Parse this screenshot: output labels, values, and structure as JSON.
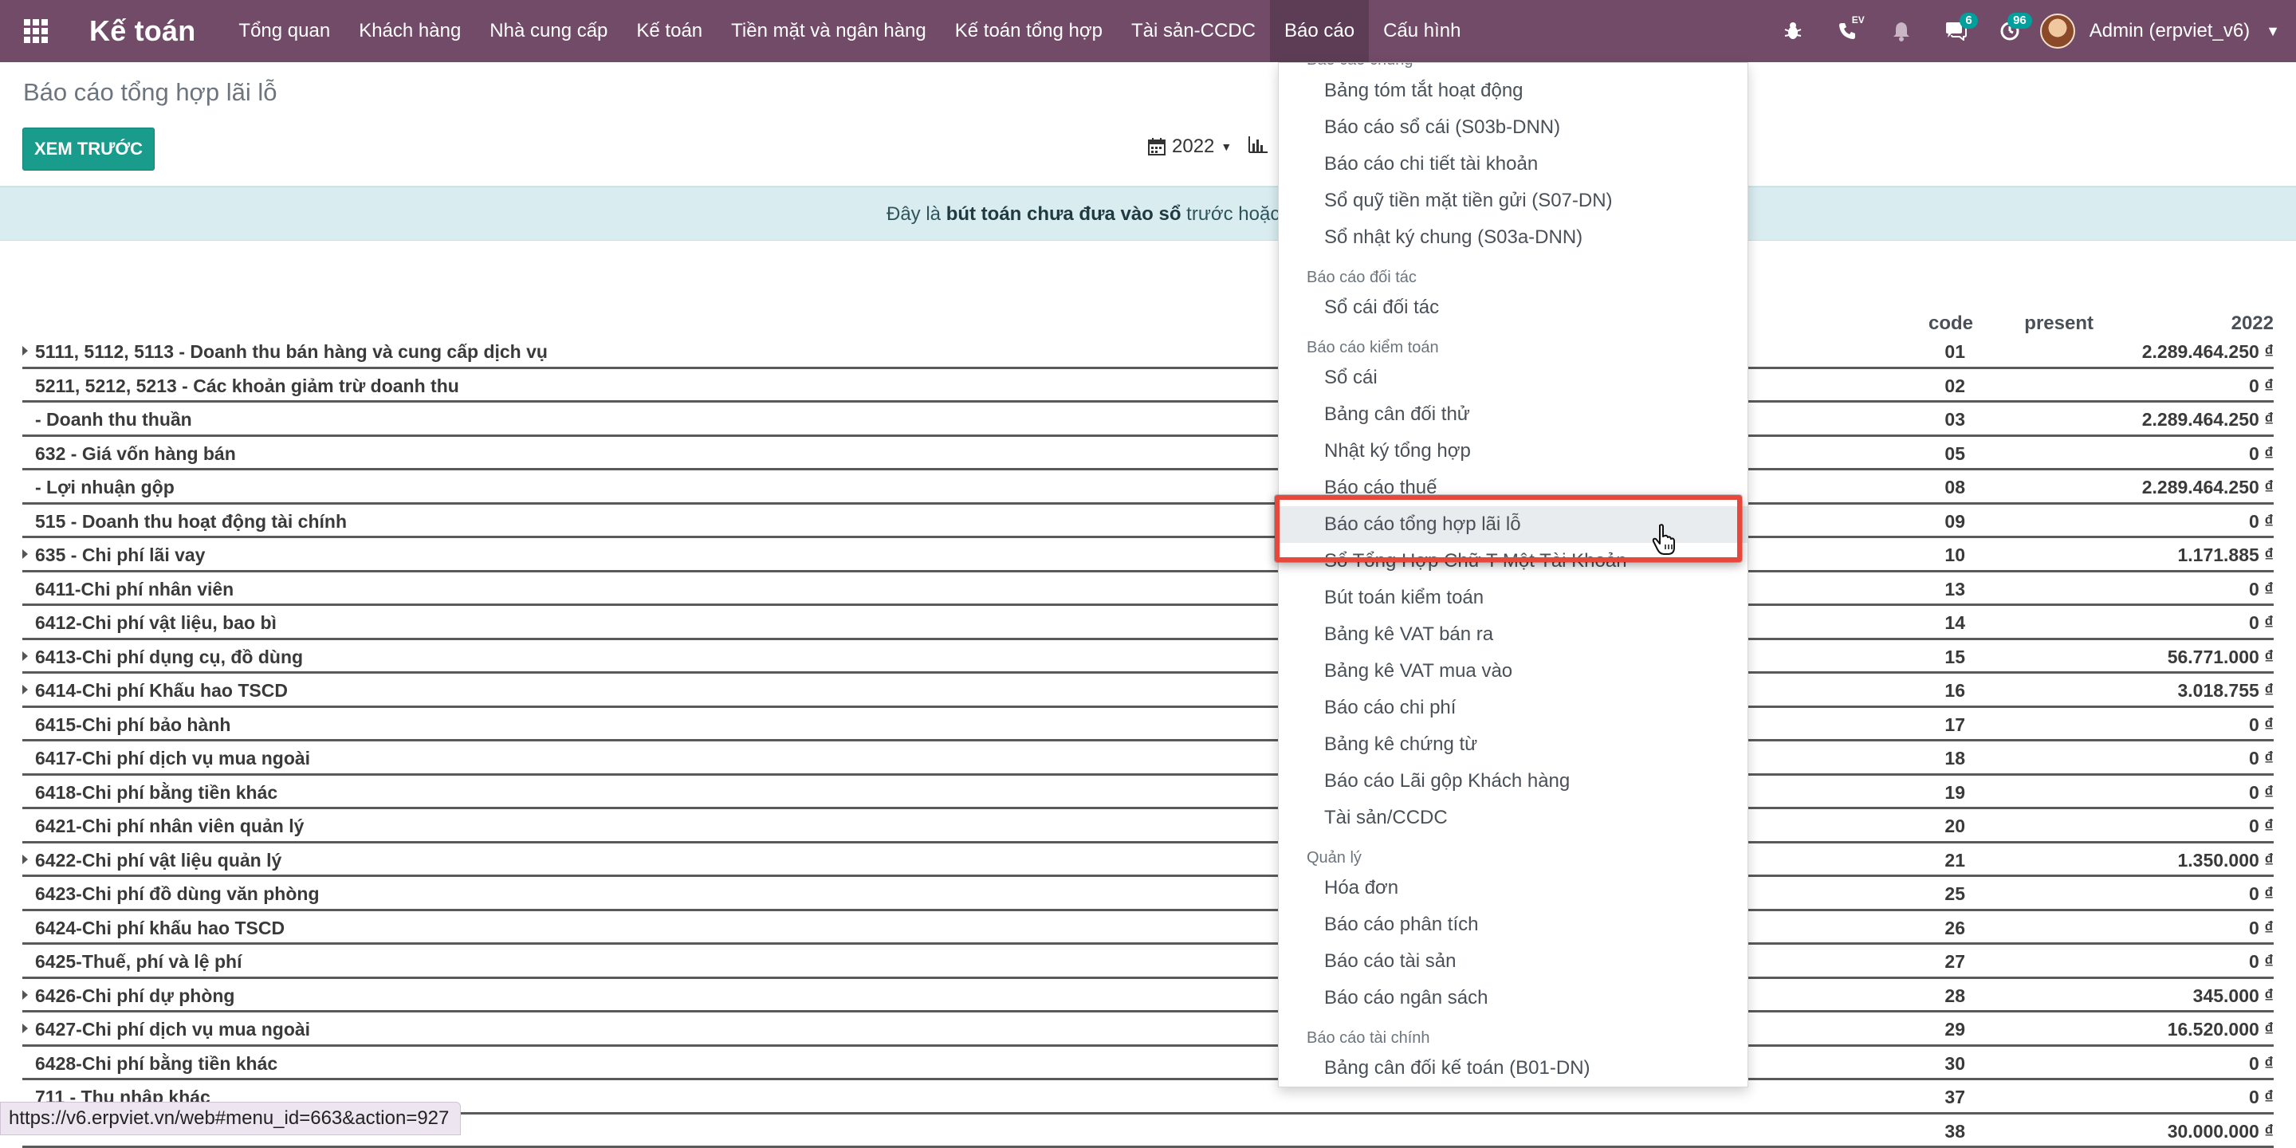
{
  "app": {
    "title": "Kế toán",
    "menu": [
      "Tổng quan",
      "Khách hàng",
      "Nhà cung cấp",
      "Kế toán",
      "Tiền mặt và ngân hàng",
      "Kế toán tổng hợp",
      "Tài sản-CCDC",
      "Báo cáo",
      "Cấu hình"
    ],
    "active_menu": "Báo cáo"
  },
  "systray": {
    "bug_icon": "bug-icon",
    "phone_tag": "EV",
    "messages_count": "6",
    "activities_count": "96",
    "user_label": "Admin (erpviet_v6)"
  },
  "page": {
    "breadcrumb": "Báo cáo tổng hợp lãi lỗ",
    "preview_button": "XEM TRƯỚC",
    "year_filter": "2022",
    "alert_prefix": "Đây là ",
    "alert_bold": "bút toán chưa đưa vào sổ",
    "alert_suffix": " trước hoặc tro"
  },
  "report": {
    "headers": {
      "code": "code",
      "present": "present",
      "year": "2022"
    },
    "rows": [
      {
        "name": "5111, 5112, 5113 - Doanh thu bán hàng và cung cấp dịch vụ",
        "code": "01",
        "amount": "2.289.464.250 ₫",
        "expandable": true
      },
      {
        "name": "5211, 5212, 5213 - Các khoản giảm trừ doanh thu",
        "code": "02",
        "amount": "0 ₫",
        "expandable": false
      },
      {
        "name": "- Doanh thu thuần",
        "code": "03",
        "amount": "2.289.464.250 ₫",
        "expandable": false
      },
      {
        "name": "632 - Giá vốn hàng bán",
        "code": "05",
        "amount": "0 ₫",
        "expandable": false
      },
      {
        "name": "- Lợi nhuận gộp",
        "code": "08",
        "amount": "2.289.464.250 ₫",
        "expandable": false
      },
      {
        "name": "515 - Doanh thu hoạt động tài chính",
        "code": "09",
        "amount": "0 ₫",
        "expandable": false
      },
      {
        "name": "635 - Chi phí lãi vay",
        "code": "10",
        "amount": "1.171.885 ₫",
        "expandable": true
      },
      {
        "name": "6411-Chi phí nhân viên",
        "code": "13",
        "amount": "0 ₫",
        "expandable": false
      },
      {
        "name": "6412-Chi phí vật liệu, bao bì",
        "code": "14",
        "amount": "0 ₫",
        "expandable": false
      },
      {
        "name": "6413-Chi phí dụng cụ, đồ dùng",
        "code": "15",
        "amount": "56.771.000 ₫",
        "expandable": true
      },
      {
        "name": "6414-Chi phí Khấu hao TSCD",
        "code": "16",
        "amount": "3.018.755 ₫",
        "expandable": true
      },
      {
        "name": "6415-Chi phí bảo hành",
        "code": "17",
        "amount": "0 ₫",
        "expandable": false
      },
      {
        "name": "6417-Chi phí dịch vụ mua ngoài",
        "code": "18",
        "amount": "0 ₫",
        "expandable": false
      },
      {
        "name": "6418-Chi phí bằng tiền khác",
        "code": "19",
        "amount": "0 ₫",
        "expandable": false
      },
      {
        "name": "6421-Chi phí nhân viên quản lý",
        "code": "20",
        "amount": "0 ₫",
        "expandable": false
      },
      {
        "name": "6422-Chi phí vật liệu quản lý",
        "code": "21",
        "amount": "1.350.000 ₫",
        "expandable": true
      },
      {
        "name": "6423-Chi phí đồ dùng văn phòng",
        "code": "25",
        "amount": "0 ₫",
        "expandable": false
      },
      {
        "name": "6424-Chi phí khấu hao TSCD",
        "code": "26",
        "amount": "0 ₫",
        "expandable": false
      },
      {
        "name": "6425-Thuế, phí và lệ phí",
        "code": "27",
        "amount": "0 ₫",
        "expandable": false
      },
      {
        "name": "6426-Chi phí dự phòng",
        "code": "28",
        "amount": "345.000 ₫",
        "expandable": true
      },
      {
        "name": "6427-Chi phí dịch vụ mua ngoài",
        "code": "29",
        "amount": "16.520.000 ₫",
        "expandable": true
      },
      {
        "name": "6428-Chi phí bằng tiền khác",
        "code": "30",
        "amount": "0 ₫",
        "expandable": false
      },
      {
        "name": "711 - Thu nhập khác",
        "code": "37",
        "amount": "0 ₫",
        "expandable": false
      },
      {
        "name": "",
        "code": "38",
        "amount": "30.000.000 ₫",
        "expandable": false
      }
    ]
  },
  "dropdown": {
    "sections": [
      {
        "header": "Báo cáo chung",
        "items": [
          "Bảng tóm tắt hoạt động",
          "Báo cáo sổ cái (S03b-DNN)",
          "Báo cáo chi tiết tài khoản",
          "Sổ quỹ tiền mặt tiền gửi (S07-DN)",
          "Sổ nhật ký chung (S03a-DNN)"
        ]
      },
      {
        "header": "Báo cáo đối tác",
        "items": [
          "Sổ cái đối tác"
        ]
      },
      {
        "header": "Báo cáo kiểm toán",
        "items": [
          "Sổ cái",
          "Bảng cân đối thử",
          "Nhật ký tổng hợp",
          "Báo cáo thuế",
          "Báo cáo tổng hợp lãi lỗ",
          "Sổ Tổng Hợp Chữ T Một Tài Khoản",
          "Bút toán kiểm toán",
          "Bảng kê VAT bán ra",
          "Bảng kê VAT mua vào",
          "Báo cáo chi phí",
          "Bảng kê chứng từ",
          "Báo cáo Lãi gộp Khách hàng",
          "Tài sản/CCDC"
        ]
      },
      {
        "header": "Quản lý",
        "items": [
          "Hóa đơn",
          "Báo cáo phân tích",
          "Báo cáo tài sản",
          "Báo cáo ngân sách"
        ]
      },
      {
        "header": "Báo cáo tài chính",
        "items": [
          "Bảng cân đối kế toán (B01-DN)"
        ]
      }
    ],
    "hovered_item": "Báo cáo tổng hợp lãi lỗ"
  },
  "status_url": "https://v6.erpviet.vn/web#menu_id=663&action=927",
  "colors": {
    "navbar": "#714b67",
    "primary_button": "#1a9c8c",
    "alert_bg": "#d9edf1",
    "highlight": "#e8483c",
    "badge": "#00a09d"
  }
}
